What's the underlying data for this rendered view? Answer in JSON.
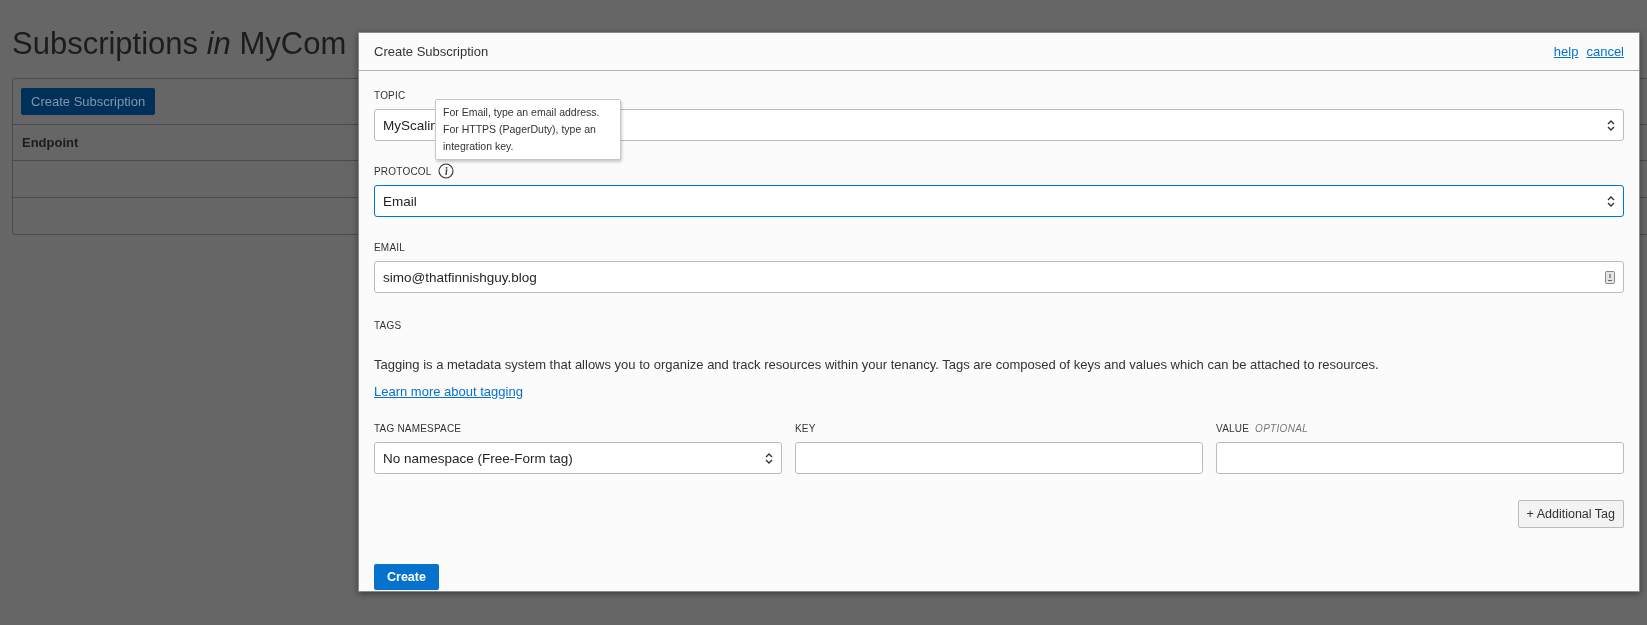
{
  "page": {
    "title": "Subscriptions *in* MyCom",
    "create_button": "Create Subscription",
    "table": {
      "columns": [
        "Endpoint"
      ]
    }
  },
  "dialog": {
    "title": "Create Subscription",
    "links": [
      "help",
      "cancel"
    ],
    "fields": [
      {
        "kind": "select",
        "label": "TOPIC",
        "info": false,
        "focused": false,
        "value": "MyScalin"
      },
      {
        "kind": "select",
        "label": "PROTOCOL",
        "info": true,
        "focused": true,
        "value": "Email"
      },
      {
        "kind": "input",
        "label": "EMAIL",
        "info": false,
        "focused": false,
        "value": "simo@thatfinnishguy.blog"
      }
    ],
    "tooltip": "For Email, type an email address. For HTTPS (PagerDuty), type an integration key.",
    "tags": {
      "label": "TAGS",
      "description": "Tagging is a metadata system that allows you to organize and track resources within your tenancy. Tags are composed of keys and values which can be attached to resources.",
      "link": "Learn more about tagging",
      "columns": [
        {
          "kind": "select",
          "label": "TAG NAMESPACE",
          "value": "No namespace (Free-Form tag)"
        },
        {
          "kind": "input",
          "label": "KEY"
        },
        {
          "kind": "input",
          "label": "VALUE",
          "optional": "OPTIONAL"
        }
      ],
      "add_button": "+ Additional Tag"
    },
    "submit": "Create"
  }
}
